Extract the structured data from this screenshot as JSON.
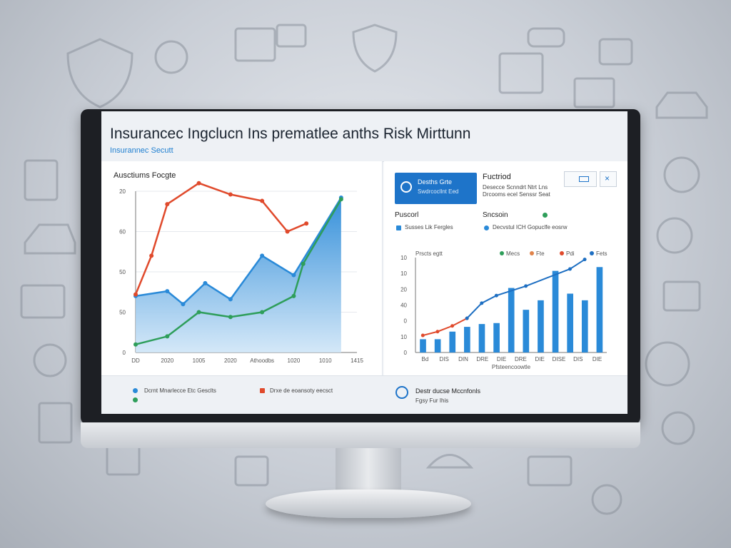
{
  "header": {
    "title": "Insurancec Ingclucn Ins prematlee anths Risk Mirttunn",
    "subtitle": "Insurannec Secutt"
  },
  "left_panel": {
    "title": "Ausctiums Focgte"
  },
  "right_panel": {
    "button": {
      "line1": "Desths Grte",
      "line2": "Swdrcocllnt Eed"
    },
    "heading": "Fuctriod",
    "heading_sub1": "Desecce Scnndrt Ntrt Lns",
    "heading_sub2": "Drcooms ecel Senssr Seat",
    "col1_label": "Puscorl",
    "col1_item": "Susses Lik Fergles",
    "col2_label": "Sncsoin",
    "col2_item": "Decvstul ICH Gopuclfe eosrw"
  },
  "footer": {
    "left_legend_1": "Dcrnt Mnarlecce Etc Gesclts",
    "left_legend_2": "Drxe de eoansoty eecsct",
    "right_title": "Destr ducse Mccnfonls",
    "right_sub": "Fgsy Fur Ihis"
  },
  "colors": {
    "blue": "#2a8ad8",
    "green": "#2e9e5a",
    "red": "#e04a2c",
    "accent": "#1e74c9"
  },
  "chart_data": [
    {
      "type": "line",
      "title": "Ausctiums Focgte",
      "x_ticks": [
        "DD",
        "2020",
        "1005",
        "2020",
        "Athoodbs",
        "1020",
        "1010",
        "1415"
      ],
      "y_ticks": [
        "0",
        "50",
        "50",
        "60",
        "20"
      ],
      "x_range": [
        0,
        7
      ],
      "y_range": [
        0,
        100
      ],
      "series": [
        {
          "color": "#2a8ad8",
          "area": true,
          "points": [
            [
              0,
              35
            ],
            [
              1,
              38
            ],
            [
              1.5,
              30
            ],
            [
              2.2,
              43
            ],
            [
              3,
              33
            ],
            [
              4,
              60
            ],
            [
              5,
              48
            ],
            [
              6.5,
              96
            ]
          ]
        },
        {
          "color": "#2e9e5a",
          "points": [
            [
              0,
              5
            ],
            [
              1,
              10
            ],
            [
              2,
              25
            ],
            [
              3,
              22
            ],
            [
              4,
              25
            ],
            [
              5,
              35
            ],
            [
              5.3,
              55
            ],
            [
              6.5,
              95
            ]
          ]
        },
        {
          "color": "#e04a2c",
          "points": [
            [
              0,
              36
            ],
            [
              0.5,
              60
            ],
            [
              1,
              92
            ],
            [
              2,
              105
            ],
            [
              3,
              98
            ],
            [
              4,
              94
            ],
            [
              4.8,
              75
            ],
            [
              5.4,
              80
            ]
          ]
        }
      ]
    },
    {
      "type": "bar",
      "title": "Prscts egtt",
      "legend": [
        "Mecs",
        "Fte",
        "Pdi",
        "Fets"
      ],
      "x_ticks": [
        "Bd",
        "DIS",
        "DIN",
        "DRE",
        "DIE",
        "DRE",
        "DIE",
        "DISE",
        "DIS",
        "DIE"
      ],
      "y_ticks": [
        "0",
        "10",
        "0",
        "40",
        "20",
        "10",
        "10"
      ],
      "x_label": "Pfsteencoowtle",
      "y_range": [
        0,
        100
      ],
      "values": [
        14,
        14,
        22,
        27,
        30,
        31,
        68,
        45,
        55,
        86,
        62,
        55,
        90
      ],
      "line_series": [
        {
          "color": "#e04a2c",
          "points": [
            [
              0,
              18
            ],
            [
              1,
              22
            ],
            [
              2,
              28
            ],
            [
              3,
              36
            ]
          ]
        },
        {
          "color": "#1e6fc2",
          "points": [
            [
              3,
              36
            ],
            [
              4,
              52
            ],
            [
              5,
              60
            ],
            [
              7,
              70
            ],
            [
              10,
              88
            ],
            [
              11,
              98
            ]
          ]
        }
      ]
    }
  ]
}
